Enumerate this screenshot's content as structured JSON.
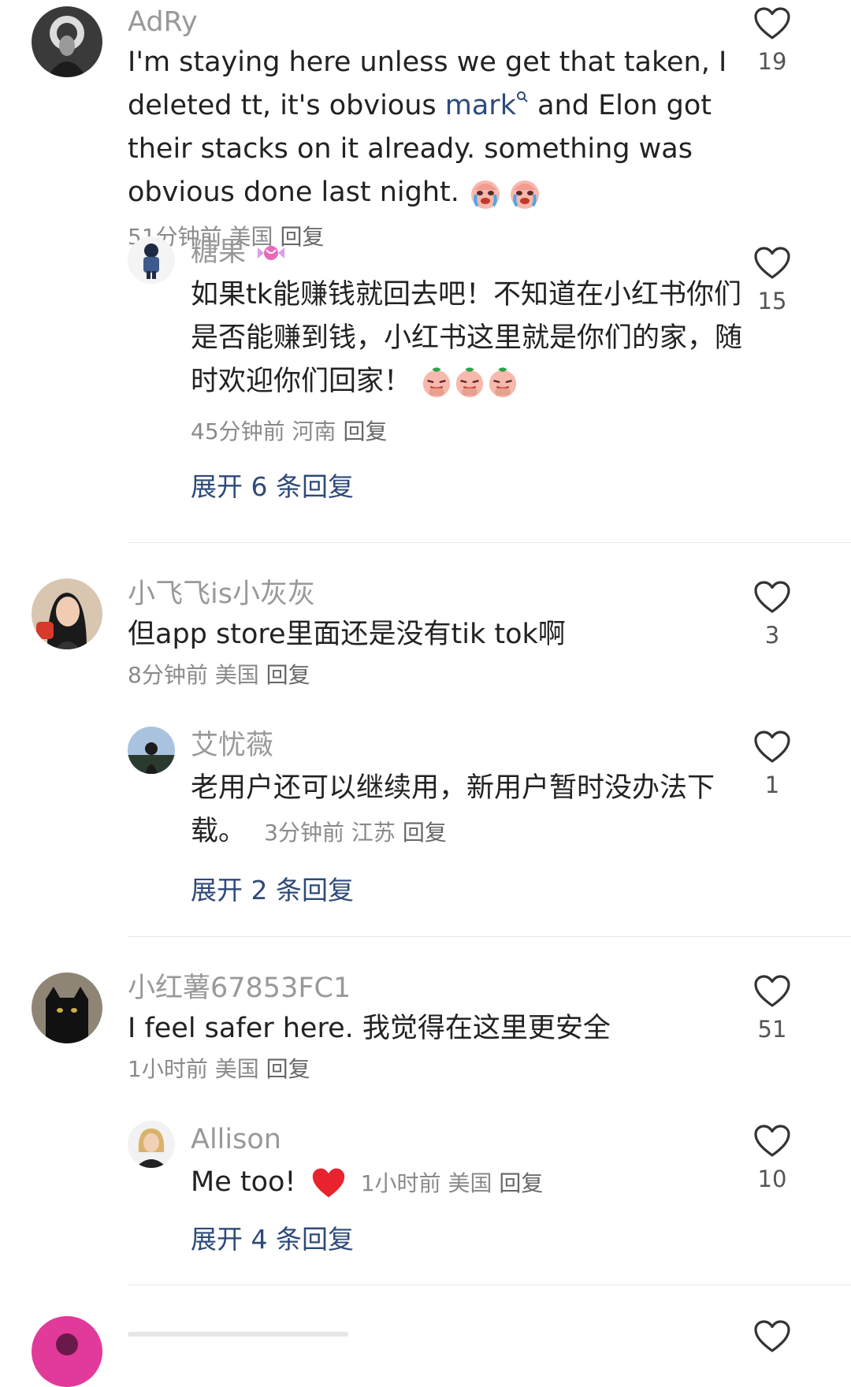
{
  "comments": [
    {
      "username": "AdRy",
      "text_before_mention": "I'm staying here unless we get that taken,  I deleted tt, it's obvious ",
      "mention": "mark",
      "text_after_mention": "  and Elon got their stacks on it already. something was obvious done last night.",
      "meta_time": "51分钟前",
      "meta_location": "美国",
      "meta_reply": "回复",
      "likes": "19",
      "reply": {
        "username": "糖果",
        "text": "如果tk能赚钱就回去吧！不知道在小红书你们是否能赚到钱，小红书这里就是你们的家，随时欢迎你们回家！",
        "meta_time": "45分钟前",
        "meta_location": "河南",
        "meta_reply": "回复",
        "likes": "15"
      },
      "expand": "展开 6 条回复"
    },
    {
      "username": "小飞飞is小灰灰",
      "text": "但app store里面还是没有tik tok啊",
      "meta_time": "8分钟前",
      "meta_location": "美国",
      "meta_reply": "回复",
      "likes": "3",
      "reply": {
        "username": "艾忧薇",
        "text": "老用户还可以继续用，新用户暂时没办法下载。",
        "meta_time": "3分钟前",
        "meta_location": "江苏",
        "meta_reply": "回复",
        "likes": "1"
      },
      "expand": "展开 2 条回复"
    },
    {
      "username": "小红薯67853FC1",
      "text": "I feel safer here. 我觉得在这里更安全",
      "meta_time": "1小时前",
      "meta_location": "美国",
      "meta_reply": "回复",
      "likes": "51",
      "reply": {
        "username": "Allison",
        "text": "Me too!",
        "meta_time": "1小时前",
        "meta_location": "美国",
        "meta_reply": "回复",
        "likes": "10"
      },
      "expand": "展开 4 条回复"
    }
  ],
  "icons": {
    "like": "heart-outline-icon",
    "search": "search-icon",
    "crying": "crying-face-emoji",
    "pleading": "pleading-face-emoji",
    "heart": "red-heart-emoji"
  },
  "colors": {
    "username": "#999999",
    "text": "#222222",
    "link": "#2e4a78",
    "divider": "#e8e8e8",
    "emoji_heart": "#e8232e"
  }
}
